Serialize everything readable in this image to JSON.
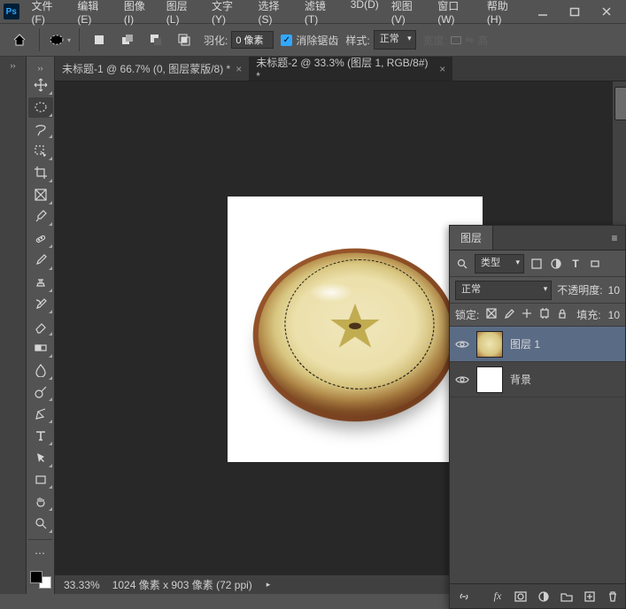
{
  "titlebar": {
    "app": "Ps",
    "menu": [
      "文件(F)",
      "编辑(E)",
      "图像(I)",
      "图层(L)",
      "文字(Y)",
      "选择(S)",
      "滤镜(T)",
      "3D(D)",
      "视图(V)",
      "窗口(W)",
      "帮助(H)"
    ]
  },
  "options": {
    "feather_label": "羽化:",
    "feather_value": "0 像素",
    "antialias_label": "消除锯齿",
    "style_label": "样式:",
    "style_value": "正常",
    "width_label": "宽度:",
    "height_label": "高"
  },
  "tabs": [
    {
      "title": "未标题-1 @ 66.7% (0, 图层蒙版/8) *",
      "active": false
    },
    {
      "title": "未标题-2 @ 33.3% (图层 1, RGB/8#) *",
      "active": true
    }
  ],
  "status": {
    "zoom": "33.33%",
    "info": "1024 像素 x 903 像素 (72 ppi)"
  },
  "tools": [
    "move",
    "ellipse-marquee",
    "lasso",
    "magic-wand",
    "crop",
    "frame",
    "slice",
    "eyedropper",
    "spot-heal",
    "brush",
    "clone",
    "history-brush",
    "eraser",
    "gradient",
    "blur",
    "dodge",
    "pen",
    "type",
    "path-select",
    "rectangle-shape",
    "hand",
    "zoom"
  ],
  "active_tool": "ellipse-marquee",
  "layers_panel": {
    "tab_label": "图层",
    "filter_label": "类型",
    "search_icon": "search",
    "blend_mode": "正常",
    "opacity_label": "不透明度:",
    "opacity_value": "10",
    "lock_label": "锁定:",
    "fill_label": "填充:",
    "fill_value": "10",
    "layers": [
      {
        "name": "图层 1",
        "visible": true,
        "selected": true,
        "thumb": "apple"
      },
      {
        "name": "背景",
        "visible": true,
        "selected": false,
        "thumb": "white"
      }
    ]
  }
}
